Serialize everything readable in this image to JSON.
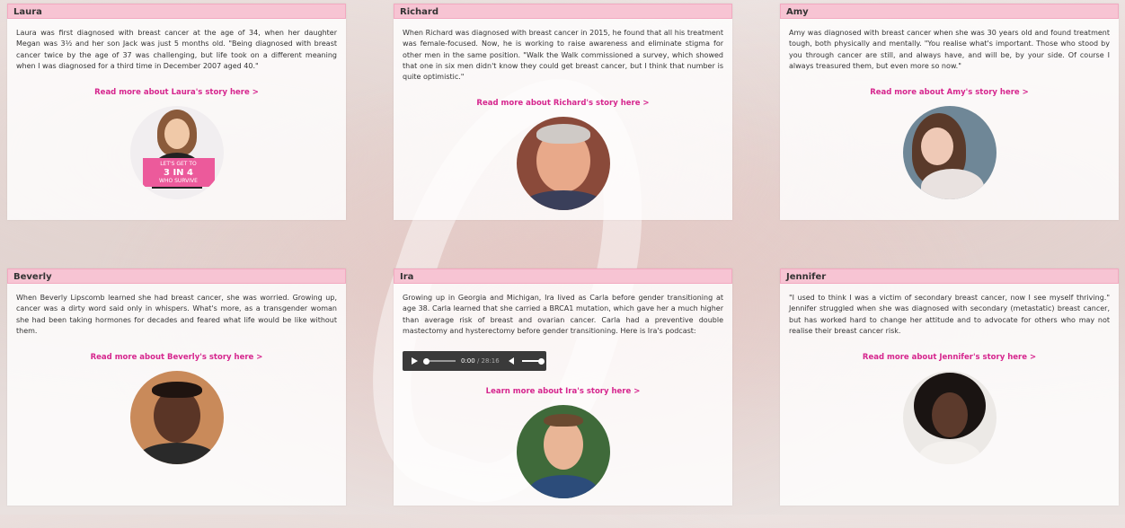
{
  "stories": [
    {
      "name": "Laura",
      "text": "Laura was first diagnosed with breast cancer at the age of 34, when her daughter Megan was 3½ and her son Jack was just 5 months old. \"Being diagnosed with breast cancer twice by the age of 37 was challenging, but life took on a different meaning when I was diagnosed for a third time in December 2007 aged 40.\"",
      "link": "Read more about Laura's story here >",
      "badge_top": "LET'S GET TO",
      "badge_mid": "3 IN 4",
      "badge_bottom": "WHO SURVIVE"
    },
    {
      "name": "Richard",
      "text": "When Richard was diagnosed with breast cancer in 2015, he found that all his treatment was female-focused. Now, he is working to raise awareness and eliminate stigma for other men in the same position. \"Walk the Walk commissioned a survey, which showed that one in six men didn't know they could get breast cancer, but I think that number is quite optimistic.\"",
      "link": "Read more about Richard's story here >"
    },
    {
      "name": "Amy",
      "text": "Amy was diagnosed with breast cancer when she was 30 years old and found treatment tough, both physically and mentally. \"You realise what's important. Those who stood by you through cancer are still, and always have, and will be, by your side. Of course I always treasured them, but even more so now.\"",
      "link": "Read more about Amy's story here >"
    },
    {
      "name": "Beverly",
      "text": "When Beverly Lipscomb learned she had breast cancer, she was worried. Growing up, cancer was a dirty word said only in whispers. What's more, as a transgender woman she had been taking hormones for decades and feared what life would be like without them.",
      "link": "Read more about Beverly's story here >"
    },
    {
      "name": "Ira",
      "text": "Growing up in Georgia and Michigan, Ira lived as Carla before gender transitioning at age 38. Carla learned that she carried a BRCA1 mutation, which gave her a much higher than average risk of breast and ovarian cancer. Carla had a preventive double mastectomy and hysterectomy before gender transitioning. Here is Ira's podcast:",
      "audio_current": "0:00",
      "audio_total": " / 28:16",
      "link": "Learn more about Ira's story here >"
    },
    {
      "name": "Jennifer",
      "text": "\"I used to think I was a victim of secondary breast cancer, now I see myself thriving.\" Jennifer struggled when she was diagnosed with secondary (metastatic) breast cancer, but has worked hard to change her attitude and to advocate for others who may not realise their breast cancer risk.",
      "link": "Read more about Jennifer's story here >"
    }
  ],
  "colors": {
    "header_bg": "#f7c4d3",
    "link": "#d6268e"
  }
}
